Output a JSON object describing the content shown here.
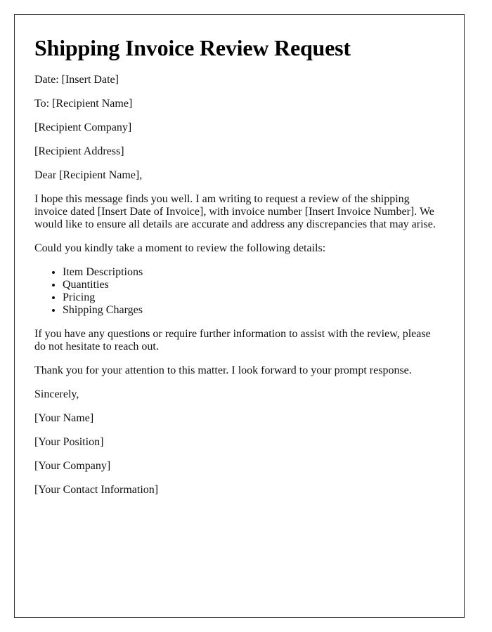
{
  "letter": {
    "title": "Shipping Invoice Review Request",
    "date_line": "Date: [Insert Date]",
    "to_line": "To: [Recipient Name]",
    "recipient_company": "[Recipient Company]",
    "recipient_address": "[Recipient Address]",
    "salutation": "Dear [Recipient Name],",
    "intro_paragraph": "I hope this message finds you well. I am writing to request a review of the shipping invoice dated [Insert Date of Invoice], with invoice number [Insert Invoice Number]. We would like to ensure all details are accurate and address any discrepancies that may arise.",
    "list_intro": "Could you kindly take a moment to review the following details:",
    "review_items": [
      "Item Descriptions",
      "Quantities",
      "Pricing",
      "Shipping Charges"
    ],
    "questions_paragraph": "If you have any questions or require further information to assist with the review, please do not hesitate to reach out.",
    "thanks_paragraph": "Thank you for your attention to this matter. I look forward to your prompt response.",
    "closing": "Sincerely,",
    "sender_name": "[Your Name]",
    "sender_position": "[Your Position]",
    "sender_company": "[Your Company]",
    "sender_contact": "[Your Contact Information]"
  }
}
